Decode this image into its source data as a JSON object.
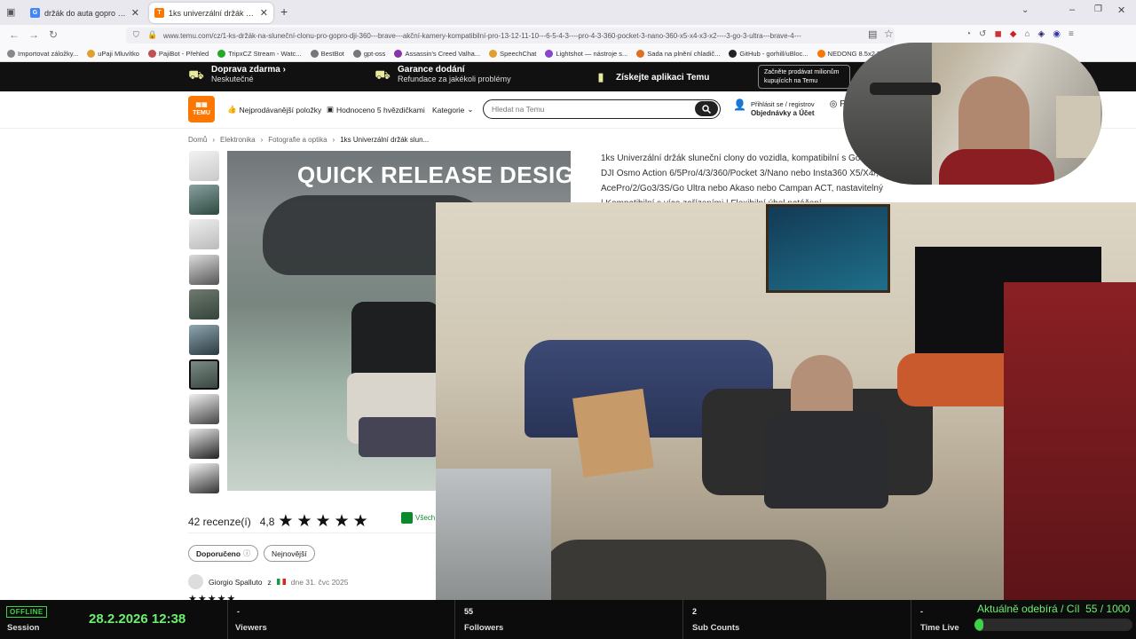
{
  "browser": {
    "tabs": [
      {
        "title": "držák do auta gopro 9 temu - Hle",
        "favicon": "G",
        "favicon_color": "#4285f4"
      },
      {
        "title": "1ks univerzální držák sluneční cl",
        "favicon": "T",
        "favicon_color": "#fb7701"
      }
    ],
    "url": "www.temu.com/cz/1-ks-držák-na-sluneční-clonu-pro-gopro-dji-360---brave---akční-kamery-kompatibilní-pro-13-12-11-10---6-5-4-3----pro-4-3-360-pocket-3-nano-360-x5-x4-x3-x2----3-go-3-ultra---brave-4---",
    "bookmarks": [
      {
        "label": "Importovat záložky...",
        "color": "#888"
      },
      {
        "label": "uPaji Mluvítko",
        "color": "#e0a030"
      },
      {
        "label": "PajiBot - Přehled",
        "color": "#c05050"
      },
      {
        "label": "TripxCZ Stream - Watc...",
        "color": "#22aa22"
      },
      {
        "label": "BestBot",
        "color": "#777"
      },
      {
        "label": "gpt-oss",
        "color": "#777"
      },
      {
        "label": "Assassin's Creed Valha...",
        "color": "#8833aa"
      },
      {
        "label": "SpeechChat",
        "color": "#e0a030"
      },
      {
        "label": "Lightshot — nástroje s...",
        "color": "#8844cc"
      },
      {
        "label": "Sada na plnění chladič...",
        "color": "#e07020"
      },
      {
        "label": "GitHub - gorhill/uBloc...",
        "color": "#222"
      },
      {
        "label": "NEDONG 8.5x2 Bezdu...",
        "color": "#fb7701"
      }
    ]
  },
  "banner": {
    "shipping_title": "Doprava zdarma ›",
    "shipping_sub": "Neskutečné",
    "guarantee_title": "Garance dodání",
    "guarantee_sub": "Refundace za jakékoli problémy",
    "app_label": "Získejte aplikaci Temu",
    "sell_text": "Začněte prodávat milionům kupujících na Temu"
  },
  "header": {
    "logo_text": "TEMU",
    "nav_bestsellers": "Nejprodávanější položky",
    "nav_rated": "Hodnoceno 5 hvězdičkami",
    "nav_category": "Kategorie",
    "search_placeholder": "Hledat na Temu",
    "account_line1": "Přihlásit se / registrov",
    "account_line2": "Objednávky a Účet",
    "support_label": "Po"
  },
  "breadcrumb": [
    "Domů",
    "Elektronika",
    "Fotografie a optika",
    "1ks Univerzální držák slun..."
  ],
  "product": {
    "image_caption": "QUICK RELEASE DESIGN",
    "title": "1ks Univerzální držák sluneční clony do vozidla, kompatibilní s GoPro, DJI Osmo Action 6/5Pro/4/3/360/Pocket 3/Nano nebo Insta360 X5/X4/, AcePro/2/Go3/3S/Go Ultra nebo Akaso nebo Campan ACT, nastavitelný | Kompatibilní s více zařízeními | Flexibilní úhel natáčení"
  },
  "reviews": {
    "count_label": "42 recenze(í)",
    "rating": "4,8",
    "rating_value": 4.8,
    "all_label": "Všech",
    "filter_recommended": "Doporučeno",
    "filter_newest": "Nejnovější",
    "reviewer_name": "Giorgio Spalluto",
    "reviewer_from": "z",
    "review_date": "dne 31. čvc 2025"
  },
  "stream": {
    "status": "OFFLINE",
    "session_label": "Session",
    "datetime": "28.2.2026 12:38",
    "viewers_value": "-",
    "viewers_label": "Viewers",
    "followers_value": "55",
    "followers_label": "Followers",
    "subs_value": "2",
    "subs_label": "Sub Counts",
    "timelive_value": "-",
    "timelive_label": "Time Live",
    "goal_label": "Aktuálně odebírá / Cíl",
    "goal_current": "55",
    "goal_target": "1000",
    "goal_text": "55 / 1000",
    "goal_fraction": 0.055,
    "accent_color": "#3fd14a"
  }
}
